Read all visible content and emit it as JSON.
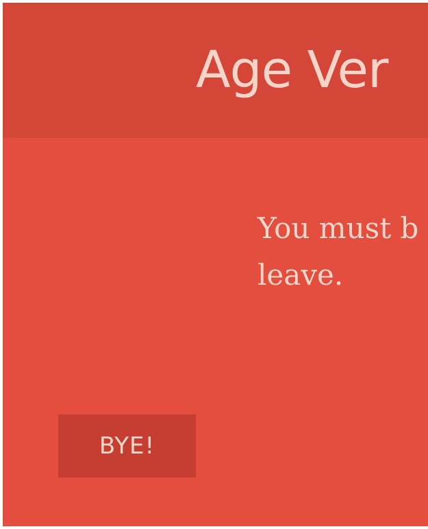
{
  "dialog": {
    "title": "Age Ver",
    "message": "You must b store. If you leave.",
    "bye_button_label": "BYE!"
  },
  "colors": {
    "background": "#e44e3e",
    "header": "#d44637",
    "button": "#c63d31",
    "text": "#f8d6c9"
  }
}
